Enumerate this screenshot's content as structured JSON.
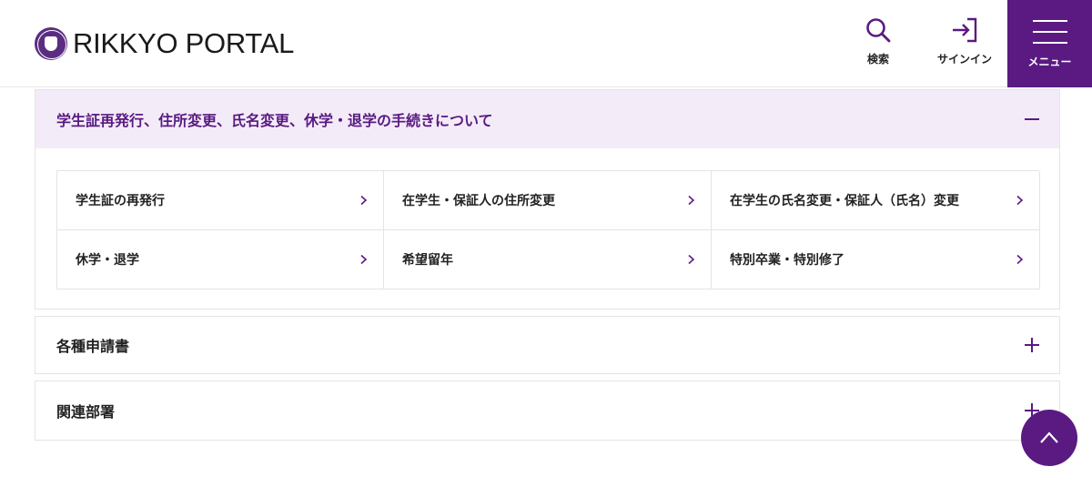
{
  "header": {
    "logo_text": "RIKKYO PORTAL",
    "search_label": "検索",
    "signin_label": "サインイン",
    "menu_label": "メニュー"
  },
  "accordions": [
    {
      "title": "学生証再発行、住所変更、氏名変更、休学・退学の手続きについて",
      "state": "open",
      "links": [
        {
          "label": "学生証の再発行"
        },
        {
          "label": "在学生・保証人の住所変更"
        },
        {
          "label": "在学生の氏名変更・保証人（氏名）変更"
        },
        {
          "label": "休学・退学"
        },
        {
          "label": "希望留年"
        },
        {
          "label": "特別卒業・特別修了"
        }
      ]
    },
    {
      "title": "各種申請書",
      "state": "closed"
    },
    {
      "title": "関連部署",
      "state": "closed"
    }
  ],
  "colors": {
    "brand": "#5a1a82",
    "accordion_open_bg": "#f3ecf8",
    "border": "#e4e4e4"
  },
  "icons": {
    "search": "search-icon",
    "signin": "signin-icon",
    "menu": "hamburger-icon",
    "collapse": "minus-icon",
    "expand": "plus-icon",
    "link": "chevron-right-icon",
    "to_top": "chevron-up-icon"
  }
}
